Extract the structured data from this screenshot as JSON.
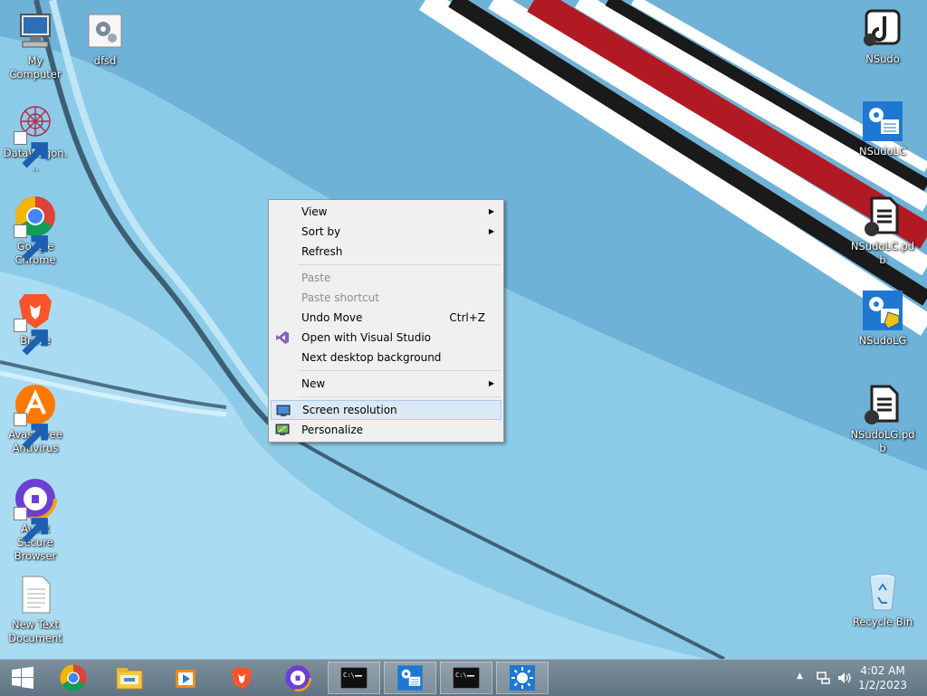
{
  "desktop": {
    "left_icons": [
      {
        "label": "My Computer",
        "icon": "computer-icon",
        "shortcut": false
      },
      {
        "label": "dfsd",
        "icon": "settings-file-icon",
        "shortcut": false
      },
      {
        "label": "DataWagon...",
        "icon": "datawagon-icon",
        "shortcut": true
      },
      {
        "label": "Google Chrome",
        "icon": "chrome-icon",
        "shortcut": true
      },
      {
        "label": "Brave",
        "icon": "brave-icon",
        "shortcut": true
      },
      {
        "label": "Avast Free Antivirus",
        "icon": "avast-icon",
        "shortcut": true
      },
      {
        "label": "Avast Secure Browser",
        "icon": "avast-secure-browser-icon",
        "shortcut": true
      },
      {
        "label": "New Text Document",
        "icon": "text-document-icon",
        "shortcut": false
      }
    ],
    "right_icons": [
      {
        "label": "NSudo",
        "icon": "nsudo-icon"
      },
      {
        "label": "NSudoLC",
        "icon": "nsudolc-icon"
      },
      {
        "label": "NSudoLC.pdb",
        "icon": "pdb-file-icon"
      },
      {
        "label": "NSudoLG",
        "icon": "nsudolg-icon"
      },
      {
        "label": "NSudoLG.pdb",
        "icon": "pdb-file-icon"
      },
      {
        "label": "Recycle Bin",
        "icon": "recycle-bin-icon"
      }
    ]
  },
  "context_menu": {
    "items": [
      {
        "label": "View",
        "submenu": true
      },
      {
        "label": "Sort by",
        "submenu": true
      },
      {
        "label": "Refresh"
      },
      {
        "label": "Paste",
        "disabled": true
      },
      {
        "label": "Paste shortcut",
        "disabled": true
      },
      {
        "label": "Undo Move",
        "shortcut": "Ctrl+Z"
      },
      {
        "label": "Open with Visual Studio",
        "icon": "visual-studio-icon"
      },
      {
        "label": "Next desktop background"
      },
      {
        "label": "New",
        "submenu": true
      },
      {
        "label": "Screen resolution",
        "icon": "screen-resolution-icon",
        "highlighted": true
      },
      {
        "label": "Personalize",
        "icon": "personalize-icon"
      }
    ]
  },
  "taskbar": {
    "items": [
      {
        "icon": "windows-start-icon"
      },
      {
        "icon": "chrome-icon"
      },
      {
        "icon": "file-explorer-icon"
      },
      {
        "icon": "media-player-icon"
      },
      {
        "icon": "brave-icon"
      },
      {
        "icon": "avast-secure-browser-icon"
      },
      {
        "icon": "command-prompt-icon",
        "active": true
      },
      {
        "icon": "nsudolc-icon",
        "active": true
      },
      {
        "icon": "command-prompt-icon",
        "active": true
      },
      {
        "icon": "brightness-icon",
        "active": true
      }
    ],
    "clock": {
      "time": "4:02 AM",
      "date": "1/2/2023"
    }
  },
  "colors": {
    "menu_highlight": "#dbe9f7",
    "taskbar": "#6a7f8d",
    "wallpaper": "#8fcbe6"
  }
}
